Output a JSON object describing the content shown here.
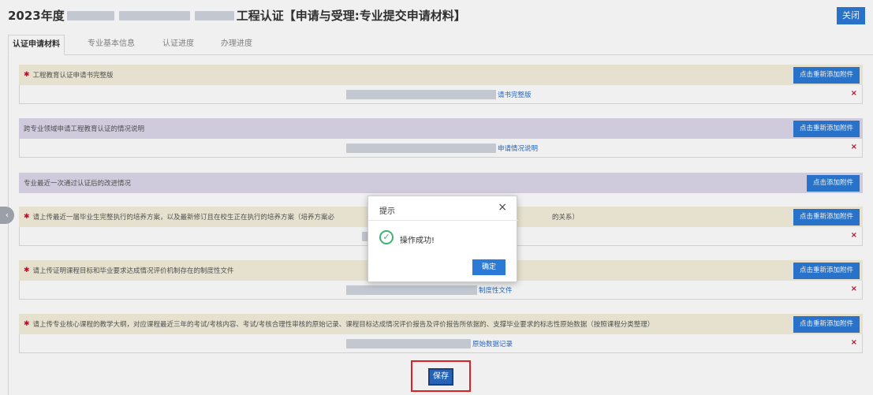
{
  "header": {
    "title_prefix": "2023年度",
    "title_suffix": "工程认证【申请与受理:专业提交申请材料】",
    "close_label": "关闭"
  },
  "tabs": [
    {
      "label": "认证申请材料"
    },
    {
      "label": "专业基本信息"
    },
    {
      "label": "认证进度"
    },
    {
      "label": "办理进度"
    }
  ],
  "sections": [
    {
      "required": "✱",
      "title": "工程教育认证申请书完整版",
      "button": "点击重新添加附件",
      "file_tail": "请书完整版",
      "delete": "×"
    },
    {
      "required": "",
      "title": "跨专业领域申请工程教育认证的情况说明",
      "button": "点击重新添加附件",
      "file_tail": "申请情况说明",
      "delete": "×"
    },
    {
      "required": "",
      "title": "专业最近一次通过认证后的改进情况",
      "button": "点击添加附件"
    },
    {
      "required": "✱",
      "title": "请上传最近一届毕业生完整执行的培养方案，以及最新修订且在校生正在执行的培养方案（培养方案必",
      "title_tail": "的关系）",
      "button": "点击重新添加附件",
      "delete": "×"
    },
    {
      "required": "✱",
      "title": "请上传证明课程目标和毕业要求达成情况评价机制存在的制度性文件",
      "button": "点击重新添加附件",
      "file_tail": "制度性文件",
      "delete": "×"
    },
    {
      "required": "✱",
      "title": "请上传专业核心课程的教学大纲，对应课程最近三年的考试/考核内容、考试/考核合理性审核的原始记录、课程目标达成情况评价报告及评价报告所依据的、支撑毕业要求的标志性原始数据（按照课程分类整理）",
      "button": "点击重新添加附件",
      "file_tail": "原始数据记录",
      "delete": "×"
    }
  ],
  "dialog": {
    "title": "提示",
    "close": "×",
    "message": "操作成功!",
    "ok": "确定"
  },
  "footer": {
    "save_label": "保存"
  },
  "icons": {
    "check": "✓",
    "left_arrow": "‹"
  }
}
